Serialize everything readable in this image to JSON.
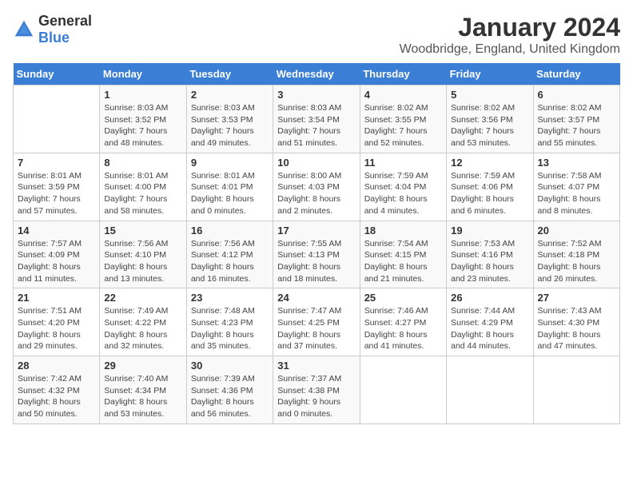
{
  "logo": {
    "general": "General",
    "blue": "Blue"
  },
  "title": "January 2024",
  "subtitle": "Woodbridge, England, United Kingdom",
  "days_header": [
    "Sunday",
    "Monday",
    "Tuesday",
    "Wednesday",
    "Thursday",
    "Friday",
    "Saturday"
  ],
  "weeks": [
    [
      {
        "day": "",
        "info": ""
      },
      {
        "day": "1",
        "info": "Sunrise: 8:03 AM\nSunset: 3:52 PM\nDaylight: 7 hours\nand 48 minutes."
      },
      {
        "day": "2",
        "info": "Sunrise: 8:03 AM\nSunset: 3:53 PM\nDaylight: 7 hours\nand 49 minutes."
      },
      {
        "day": "3",
        "info": "Sunrise: 8:03 AM\nSunset: 3:54 PM\nDaylight: 7 hours\nand 51 minutes."
      },
      {
        "day": "4",
        "info": "Sunrise: 8:02 AM\nSunset: 3:55 PM\nDaylight: 7 hours\nand 52 minutes."
      },
      {
        "day": "5",
        "info": "Sunrise: 8:02 AM\nSunset: 3:56 PM\nDaylight: 7 hours\nand 53 minutes."
      },
      {
        "day": "6",
        "info": "Sunrise: 8:02 AM\nSunset: 3:57 PM\nDaylight: 7 hours\nand 55 minutes."
      }
    ],
    [
      {
        "day": "7",
        "info": "Sunrise: 8:01 AM\nSunset: 3:59 PM\nDaylight: 7 hours\nand 57 minutes."
      },
      {
        "day": "8",
        "info": "Sunrise: 8:01 AM\nSunset: 4:00 PM\nDaylight: 7 hours\nand 58 minutes."
      },
      {
        "day": "9",
        "info": "Sunrise: 8:01 AM\nSunset: 4:01 PM\nDaylight: 8 hours\nand 0 minutes."
      },
      {
        "day": "10",
        "info": "Sunrise: 8:00 AM\nSunset: 4:03 PM\nDaylight: 8 hours\nand 2 minutes."
      },
      {
        "day": "11",
        "info": "Sunrise: 7:59 AM\nSunset: 4:04 PM\nDaylight: 8 hours\nand 4 minutes."
      },
      {
        "day": "12",
        "info": "Sunrise: 7:59 AM\nSunset: 4:06 PM\nDaylight: 8 hours\nand 6 minutes."
      },
      {
        "day": "13",
        "info": "Sunrise: 7:58 AM\nSunset: 4:07 PM\nDaylight: 8 hours\nand 8 minutes."
      }
    ],
    [
      {
        "day": "14",
        "info": "Sunrise: 7:57 AM\nSunset: 4:09 PM\nDaylight: 8 hours\nand 11 minutes."
      },
      {
        "day": "15",
        "info": "Sunrise: 7:56 AM\nSunset: 4:10 PM\nDaylight: 8 hours\nand 13 minutes."
      },
      {
        "day": "16",
        "info": "Sunrise: 7:56 AM\nSunset: 4:12 PM\nDaylight: 8 hours\nand 16 minutes."
      },
      {
        "day": "17",
        "info": "Sunrise: 7:55 AM\nSunset: 4:13 PM\nDaylight: 8 hours\nand 18 minutes."
      },
      {
        "day": "18",
        "info": "Sunrise: 7:54 AM\nSunset: 4:15 PM\nDaylight: 8 hours\nand 21 minutes."
      },
      {
        "day": "19",
        "info": "Sunrise: 7:53 AM\nSunset: 4:16 PM\nDaylight: 8 hours\nand 23 minutes."
      },
      {
        "day": "20",
        "info": "Sunrise: 7:52 AM\nSunset: 4:18 PM\nDaylight: 8 hours\nand 26 minutes."
      }
    ],
    [
      {
        "day": "21",
        "info": "Sunrise: 7:51 AM\nSunset: 4:20 PM\nDaylight: 8 hours\nand 29 minutes."
      },
      {
        "day": "22",
        "info": "Sunrise: 7:49 AM\nSunset: 4:22 PM\nDaylight: 8 hours\nand 32 minutes."
      },
      {
        "day": "23",
        "info": "Sunrise: 7:48 AM\nSunset: 4:23 PM\nDaylight: 8 hours\nand 35 minutes."
      },
      {
        "day": "24",
        "info": "Sunrise: 7:47 AM\nSunset: 4:25 PM\nDaylight: 8 hours\nand 37 minutes."
      },
      {
        "day": "25",
        "info": "Sunrise: 7:46 AM\nSunset: 4:27 PM\nDaylight: 8 hours\nand 41 minutes."
      },
      {
        "day": "26",
        "info": "Sunrise: 7:44 AM\nSunset: 4:29 PM\nDaylight: 8 hours\nand 44 minutes."
      },
      {
        "day": "27",
        "info": "Sunrise: 7:43 AM\nSunset: 4:30 PM\nDaylight: 8 hours\nand 47 minutes."
      }
    ],
    [
      {
        "day": "28",
        "info": "Sunrise: 7:42 AM\nSunset: 4:32 PM\nDaylight: 8 hours\nand 50 minutes."
      },
      {
        "day": "29",
        "info": "Sunrise: 7:40 AM\nSunset: 4:34 PM\nDaylight: 8 hours\nand 53 minutes."
      },
      {
        "day": "30",
        "info": "Sunrise: 7:39 AM\nSunset: 4:36 PM\nDaylight: 8 hours\nand 56 minutes."
      },
      {
        "day": "31",
        "info": "Sunrise: 7:37 AM\nSunset: 4:38 PM\nDaylight: 9 hours\nand 0 minutes."
      },
      {
        "day": "",
        "info": ""
      },
      {
        "day": "",
        "info": ""
      },
      {
        "day": "",
        "info": ""
      }
    ]
  ]
}
